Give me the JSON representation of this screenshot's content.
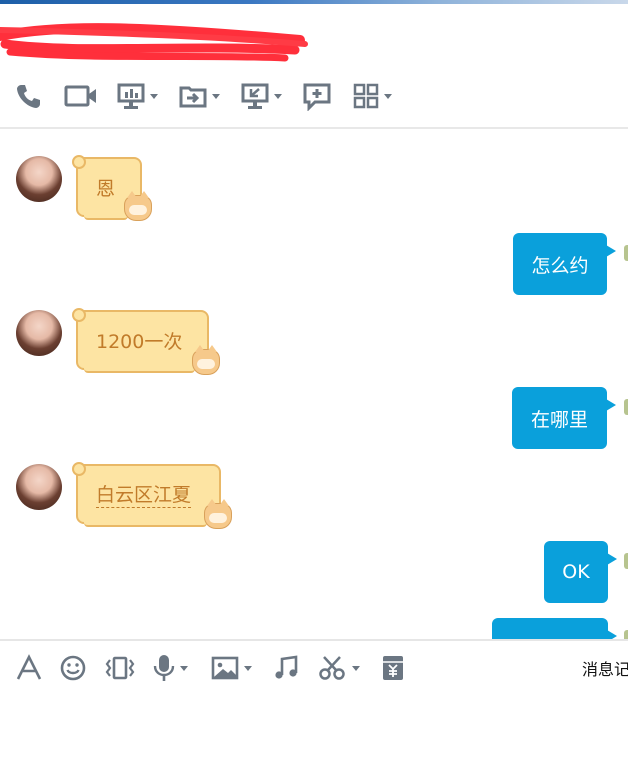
{
  "header": {
    "title_redacted": true,
    "redact_color": "#ff2f3b"
  },
  "toolbar": {
    "items": [
      {
        "icon": "phone-icon"
      },
      {
        "icon": "video-call-icon"
      },
      {
        "icon": "presentation-icon",
        "dropdown": true
      },
      {
        "icon": "file-transfer-icon",
        "dropdown": true
      },
      {
        "icon": "remote-desktop-icon",
        "dropdown": true
      },
      {
        "icon": "new-message-icon"
      },
      {
        "icon": "apps-grid-icon",
        "dropdown": true
      }
    ]
  },
  "messages": [
    {
      "direction": "in",
      "text": "恩"
    },
    {
      "direction": "out",
      "text": "怎么约"
    },
    {
      "direction": "in",
      "text": "1200一次"
    },
    {
      "direction": "out",
      "text": "在哪里"
    },
    {
      "direction": "in",
      "text": "白云区江夏"
    },
    {
      "direction": "out",
      "text": "OK"
    },
    {
      "direction": "out",
      "text": ""
    }
  ],
  "input_toolbar": {
    "items": [
      {
        "icon": "font-icon"
      },
      {
        "icon": "emoji-icon"
      },
      {
        "icon": "shake-icon"
      },
      {
        "icon": "microphone-icon",
        "dropdown": true
      },
      {
        "icon": "image-icon",
        "dropdown": true
      },
      {
        "icon": "music-icon"
      },
      {
        "icon": "scissors-icon",
        "dropdown": true
      },
      {
        "icon": "red-packet-icon"
      }
    ],
    "history_label": "消息记"
  },
  "colors": {
    "incoming_bubble_bg": "#fde4a3",
    "incoming_bubble_border": "#e9b866",
    "incoming_text": "#c17b2a",
    "outgoing_bubble_bg": "#0aa0db",
    "icon_gray": "#6b7682"
  }
}
